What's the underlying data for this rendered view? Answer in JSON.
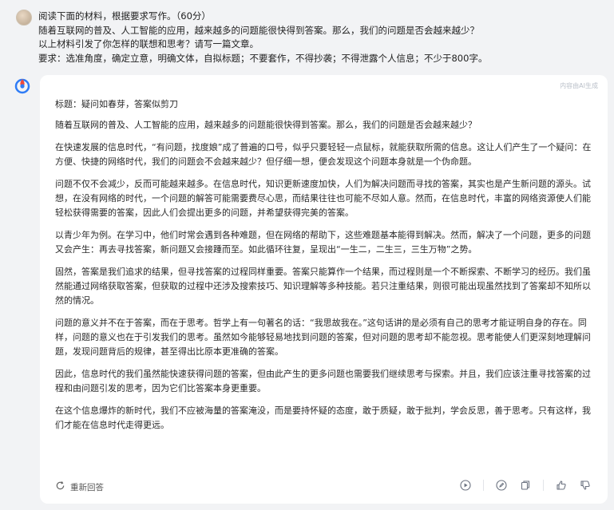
{
  "prompt": {
    "lines": [
      "阅读下面的材料，根据要求写作。（60分）",
      "随着互联网的普及、人工智能的应用，越来越多的问题能很快得到答案。那么，我们的问题是否会越来越少？",
      "以上材料引发了你怎样的联想和思考？请写一篇文章。",
      "要求：选准角度，确定立意，明确文体，自拟标题；不要套作，不得抄袭；不得泄露个人信息；不少于800字。"
    ]
  },
  "answer": {
    "copy_hint": "内容由AI生成",
    "title": "标题：疑问如春芽，答案似剪刀",
    "paragraphs": [
      "随着互联网的普及、人工智能的应用，越来越多的问题能很快得到答案。那么，我们的问题是否会越来越少？",
      "在快速发展的信息时代，“有问题，找度娘”成了普遍的口号，似乎只要轻轻一点鼠标，就能获取所需的信息。这让人们产生了一个疑问：在方便、快捷的网络时代，我们的问题会不会越来越少？但仔细一想，便会发现这个问题本身就是一个伪命题。",
      "问题不仅不会减少，反而可能越来越多。在信息时代，知识更新速度加快，人们为解决问题而寻找的答案，其实也是产生新问题的源头。试想，在没有网络的时代，一个问题的解答可能需要费尽心思，而结果往往也可能不尽如人意。然而，在信息时代，丰富的网络资源使人们能轻松获得需要的答案，因此人们会提出更多的问题，并希望获得完美的答案。",
      "以青少年为例。在学习中，他们时常会遇到各种难题，但在网络的帮助下，这些难题基本能得到解决。然而，解决了一个问题，更多的问题又会产生：再去寻找答案，新问题又会接踵而至。如此循环往复，呈现出“一生二，二生三，三生万物”之势。",
      "固然，答案是我们追求的结果，但寻找答案的过程同样重要。答案只能算作一个结果，而过程则是一个不断探索、不断学习的经历。我们虽然能通过网络获取答案，但获取的过程中还涉及搜索技巧、知识理解等多种技能。若只注重结果，则很可能出现虽然找到了答案却不知所以然的情况。",
      "问题的意义并不在于答案，而在于思考。哲学上有一句著名的话：“我思故我在。”这句话讲的是必须有自己的思考才能证明自身的存在。同样，问题的意义也在于引发我们的思考。虽然如今能够轻易地找到问题的答案，但对问题的思考却不能忽视。思考能使人们更深刻地理解问题，发现问题背后的规律，甚至得出比原本更准确的答案。",
      "因此，信息时代的我们虽然能快速获得问题的答案，但由此产生的更多问题也需要我们继续思考与探索。并且，我们应该注重寻找答案的过程和由问题引发的思考，因为它们比答案本身更重要。",
      "在这个信息爆炸的新时代，我们不应被海量的答案淹没，而是要持怀疑的态度，敢于质疑，敢于批判，学会反思，善于思考。只有这样，我们才能在信息时代走得更远。"
    ]
  },
  "footer": {
    "regenerate_label": "重新回答"
  },
  "colors": {
    "background": "#f2f3f5",
    "card": "#ffffff",
    "bot_blue": "#2f7cf6",
    "bot_red": "#f04a3a"
  }
}
